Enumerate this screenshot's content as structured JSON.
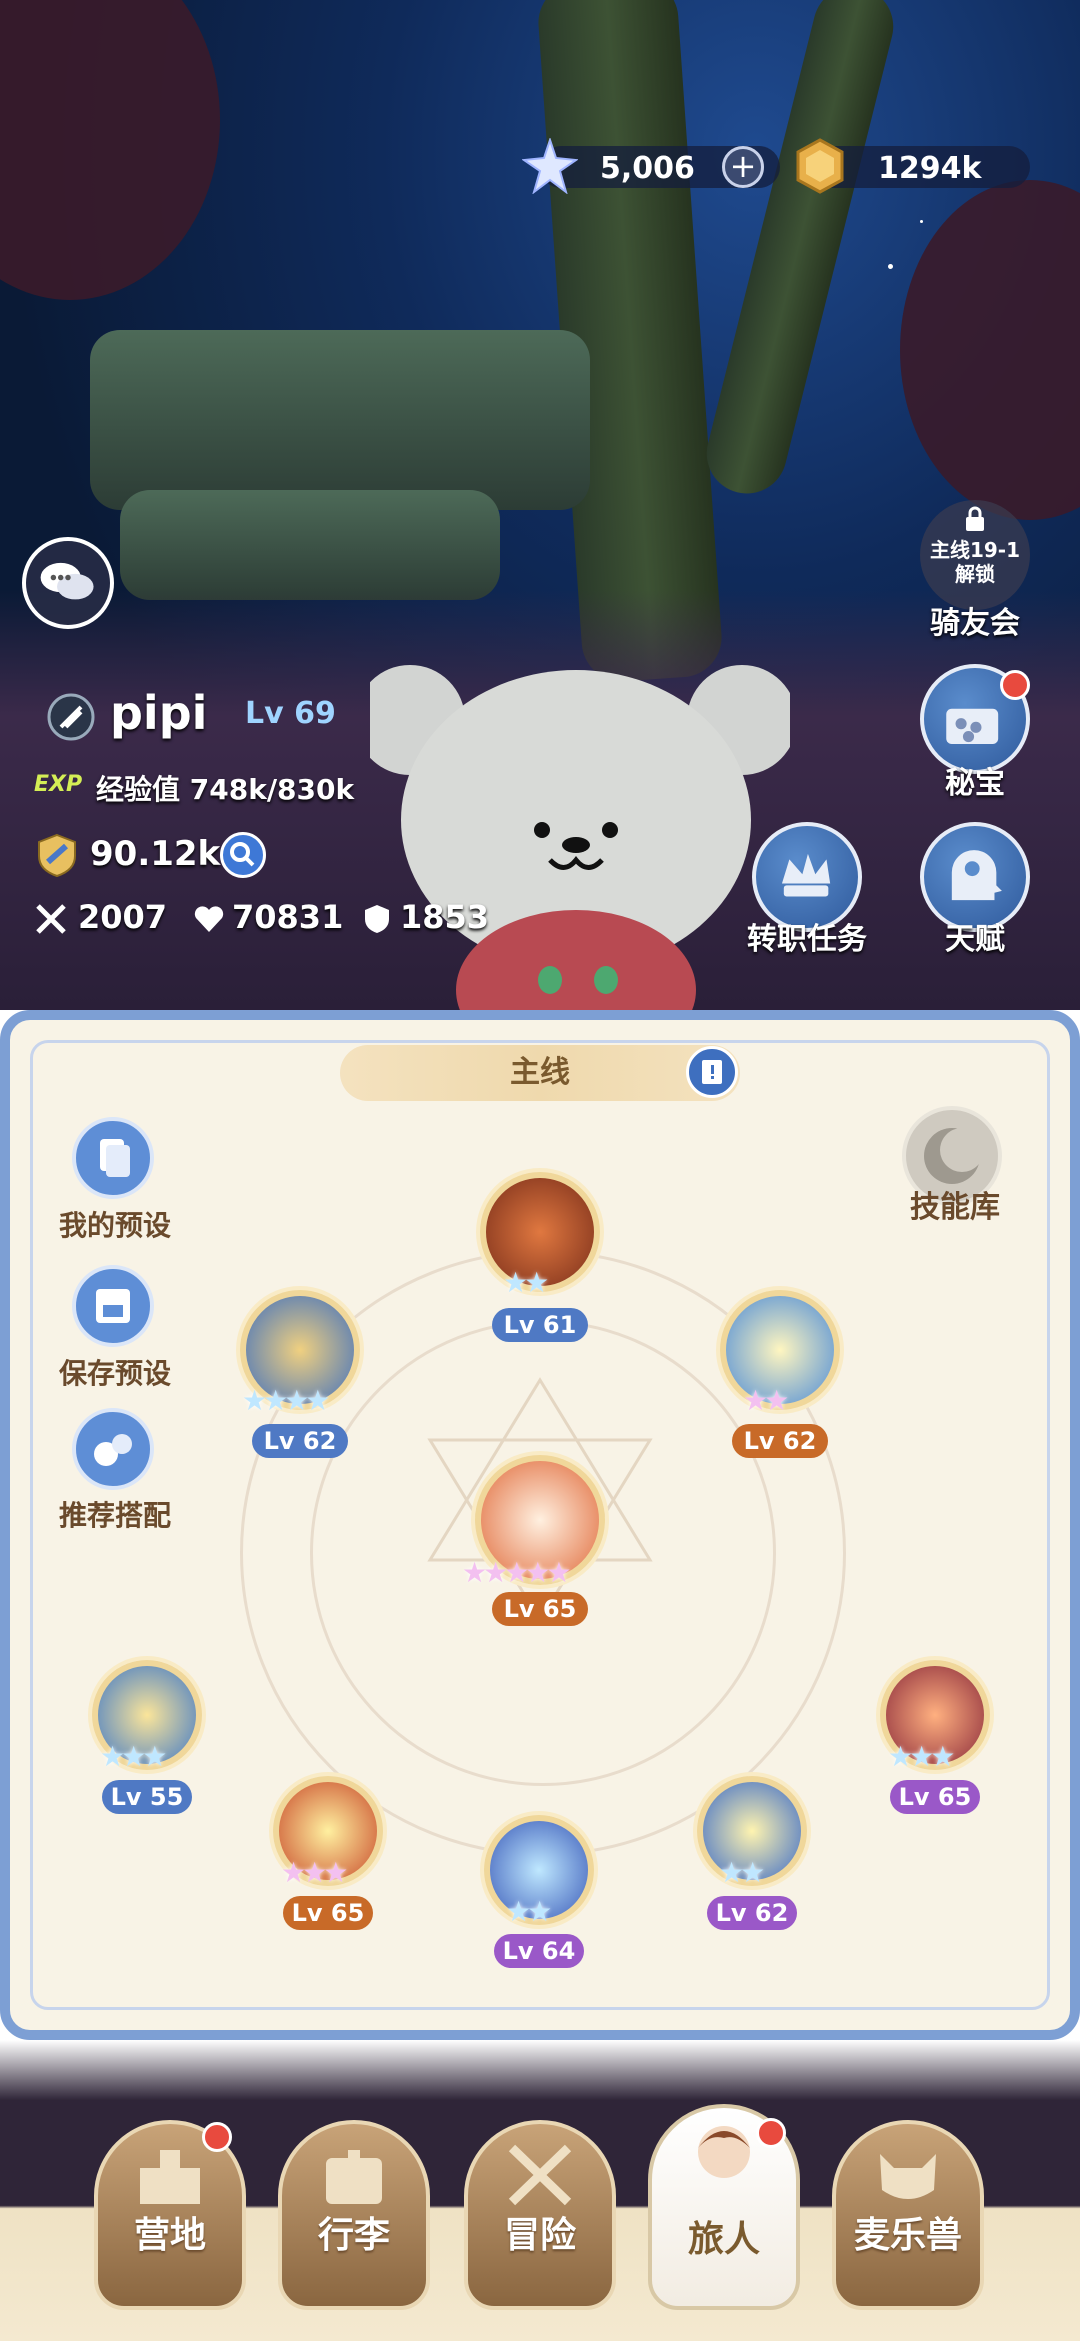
{
  "currency": {
    "gems": "5,006",
    "gold": "1294k",
    "plus": "+"
  },
  "player": {
    "name": "pipi",
    "level": "Lv 69",
    "exp_tag": "EXP",
    "exp_text": "经验值 748k/830k",
    "power": "90.12k",
    "attack": "2007",
    "hp": "70831",
    "defense": "1853"
  },
  "side_buttons": {
    "club_lock_line1": "主线19-1",
    "club_lock_line2": "解锁",
    "club": "骑友会",
    "treasure": "秘宝",
    "job_quest": "转职任务",
    "talent": "天赋"
  },
  "panel": {
    "tab": "主线",
    "presets": [
      "我的预设",
      "保存预设",
      "推荐搭配"
    ],
    "skill_library": "技能库",
    "skills": [
      {
        "lv": "Lv 61",
        "stars": "★★"
      },
      {
        "lv": "Lv 62",
        "stars": "★★★★"
      },
      {
        "lv": "Lv 62",
        "stars": "★★"
      },
      {
        "lv": "Lv 65",
        "stars": "★★★★★"
      },
      {
        "lv": "Lv 55",
        "stars": "★★★"
      },
      {
        "lv": "Lv 65",
        "stars": "★★★"
      },
      {
        "lv": "Lv 64",
        "stars": "★★"
      },
      {
        "lv": "Lv 62",
        "stars": "★★"
      },
      {
        "lv": "Lv 65",
        "stars": "★★★"
      }
    ]
  },
  "nav": [
    "营地",
    "行李",
    "冒险",
    "旅人",
    "麦乐兽"
  ],
  "colors": {
    "panel_border": "#7d9fd4",
    "lv_blue": "#4f79c4",
    "lv_orange": "#c86a28",
    "lv_purple": "#9a58c8"
  }
}
